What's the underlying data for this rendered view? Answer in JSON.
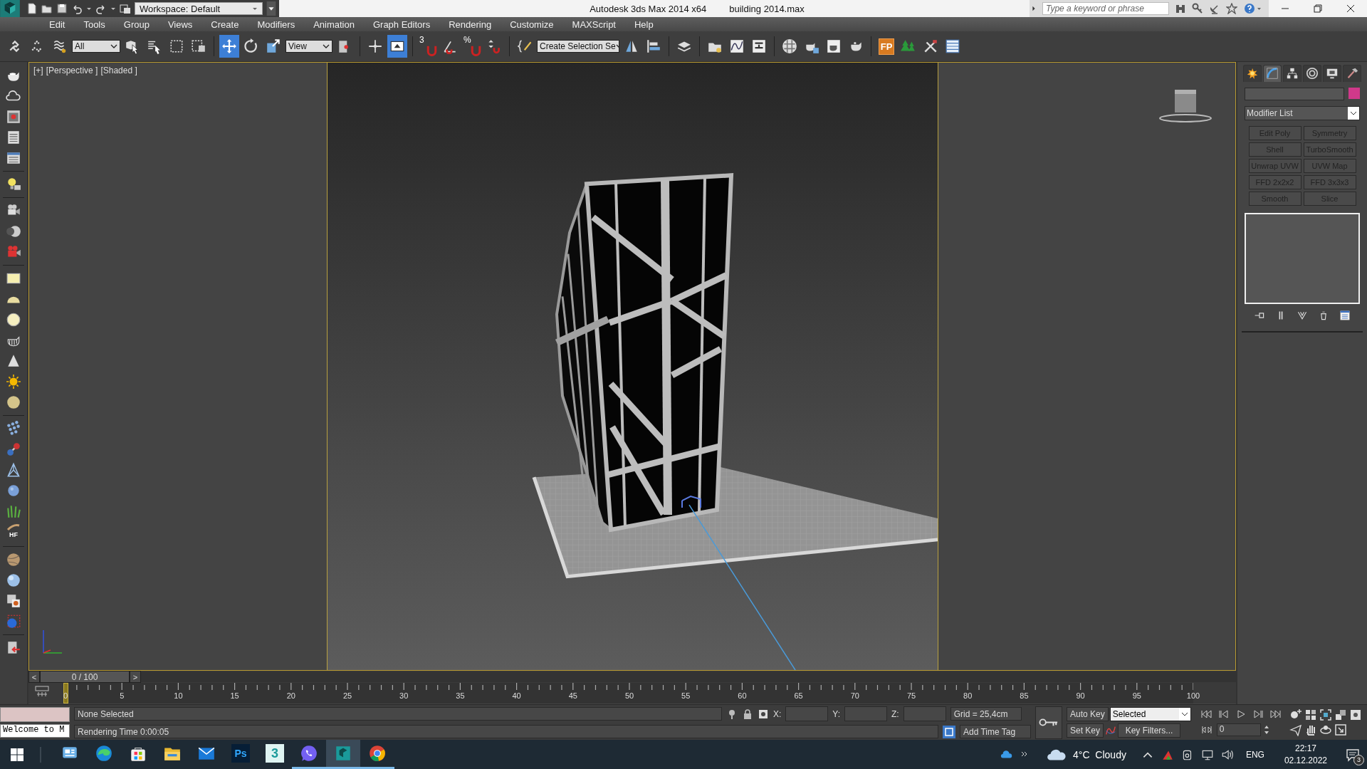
{
  "title_bar": {
    "workspace": "Workspace: Default",
    "title": "Autodesk 3ds Max  2014 x64",
    "file": "building  2014.max",
    "search": {
      "placeholder": "Type a keyword or phrase"
    }
  },
  "menu": [
    "Edit",
    "Tools",
    "Group",
    "Views",
    "Create",
    "Modifiers",
    "Animation",
    "Graph Editors",
    "Rendering",
    "Customize",
    "MAXScript",
    "Help"
  ],
  "main_toolbar": {
    "selection_filter": "All",
    "reference_coord": "View",
    "named_selection": "Create Selection Se",
    "snap_label": "3",
    "percent_snap_label": "%",
    "fp_label": "FP",
    "tools": [
      {
        "selected": false
      },
      {
        "selected": false
      },
      {
        "selected": false
      },
      {
        "selected": false
      },
      {
        "selected": false
      },
      {
        "selected": false
      },
      {
        "selected": false
      },
      {
        "selected": true
      },
      {
        "selected": false
      },
      {
        "selected": false
      },
      {
        "selected": false
      },
      {
        "selected": false
      },
      {
        "selected": true
      },
      {
        "selected": false
      },
      {
        "selected": false
      },
      {
        "selected": false
      },
      {
        "selected": false
      },
      {
        "selected": false
      },
      {
        "selected": false
      },
      {
        "selected": false
      },
      {
        "selected": false
      },
      {
        "selected": false
      },
      {
        "selected": false
      },
      {
        "selected": false
      },
      {
        "selected": false
      },
      {
        "selected": false
      },
      {
        "selected": false
      },
      {
        "selected": false
      },
      {
        "selected": false
      },
      {
        "selected": false
      },
      {
        "selected": false
      },
      {
        "selected": false
      }
    ]
  },
  "left_toolbar": {
    "hair_label": "HF"
  },
  "viewport": {
    "labels": [
      "[+]",
      "[Perspective ]",
      "[Shaded ]"
    ]
  },
  "command_panel": {
    "tabs": [
      {
        "selected": false
      },
      {
        "selected": true
      },
      {
        "selected": false
      },
      {
        "selected": false
      },
      {
        "selected": false
      },
      {
        "selected": false
      }
    ],
    "object": {
      "color": "#d0398a"
    },
    "modifier_list": "Modifier List",
    "modifier_buttons": [
      "Edit Poly",
      "Symmetry",
      "Shell",
      "TurboSmooth",
      "Unwrap UVW",
      "UVW Map",
      "FFD 2x2x2",
      "FFD 3x3x3",
      "Smooth",
      "Slice"
    ]
  },
  "time_slider": {
    "prev": "<",
    "frame": "0 / 100",
    "next": ">"
  },
  "track_bar": {
    "ticks": [
      "0",
      "5",
      "10",
      "15",
      "20",
      "25",
      "30",
      "35",
      "40",
      "45",
      "50",
      "55",
      "60",
      "65",
      "70",
      "75",
      "80",
      "85",
      "90",
      "95",
      "100"
    ]
  },
  "status": {
    "listener_output": "Welcome to M",
    "selection": "None Selected",
    "prompt": "Rendering Time  0:00:05",
    "x_label": "X:",
    "y_label": "Y:",
    "z_label": "Z:",
    "grid": "Grid = 25,4cm",
    "add_time_tag": "Add Time Tag",
    "auto_key": "Auto Key",
    "set_key": "Set Key",
    "key_mode": "Selected",
    "key_filters": "Key Filters...",
    "current_frame": "0"
  },
  "taskbar": {
    "apps": [
      {
        "selected": false,
        "running": false
      },
      {
        "selected": false,
        "running": false
      },
      {
        "selected": false,
        "running": false
      },
      {
        "selected": false,
        "running": false
      },
      {
        "selected": false,
        "running": false
      },
      {
        "label": "Ps",
        "selected": false,
        "running": false
      },
      {
        "label": "3",
        "selected": false,
        "running": false
      },
      {
        "selected": false,
        "running": true
      },
      {
        "selected": true,
        "running": true
      },
      {
        "selected": false,
        "running": true
      }
    ],
    "weather": "4°C  Cloudy",
    "language": "ENG",
    "time": "22:17",
    "date": "02.12.2022",
    "notifications": "3"
  }
}
